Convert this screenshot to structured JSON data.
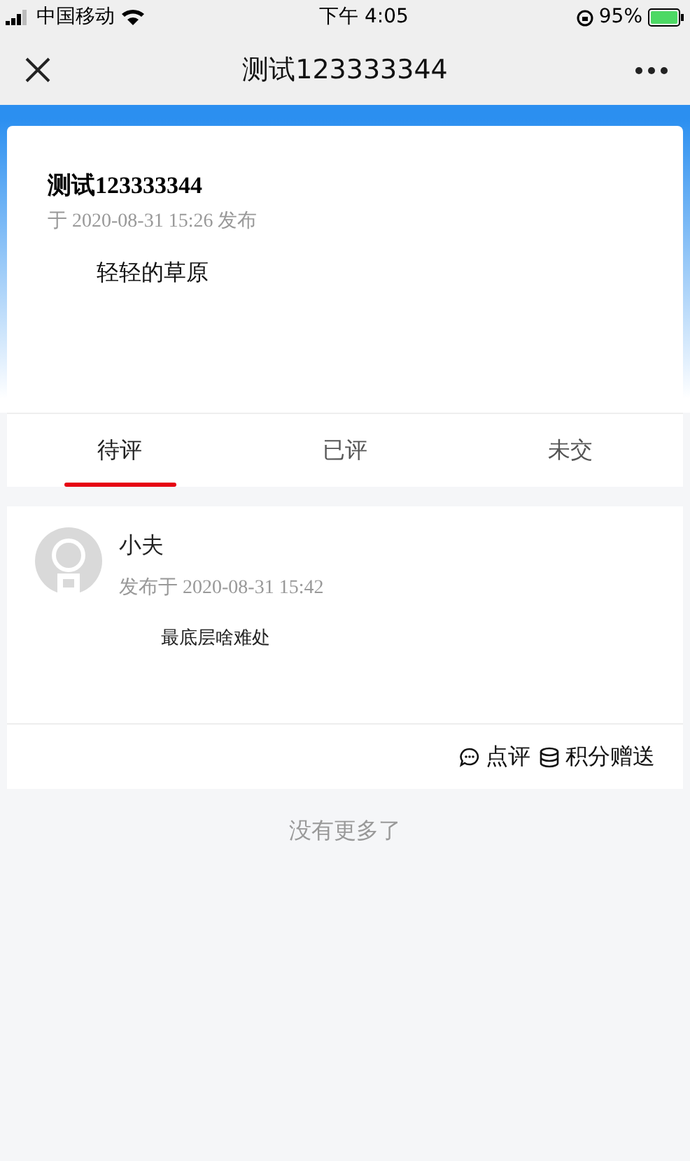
{
  "status_bar": {
    "carrier": "中国移动",
    "time": "下午 4:05",
    "battery": "95%"
  },
  "nav": {
    "title": "测试123333344"
  },
  "post": {
    "title": "测试123333344",
    "meta": "于 2020-08-31 15:26 发布",
    "body": "轻轻的草原"
  },
  "tabs": [
    {
      "label": "待评",
      "selected": true
    },
    {
      "label": "已评",
      "selected": false
    },
    {
      "label": "未交",
      "selected": false
    }
  ],
  "submissions": [
    {
      "name": "小夫",
      "meta": "发布于 2020-08-31 15:42",
      "body": "最底层啥难处",
      "actions": [
        "点评",
        "积分赠送"
      ]
    }
  ],
  "end_note": "没有更多了"
}
